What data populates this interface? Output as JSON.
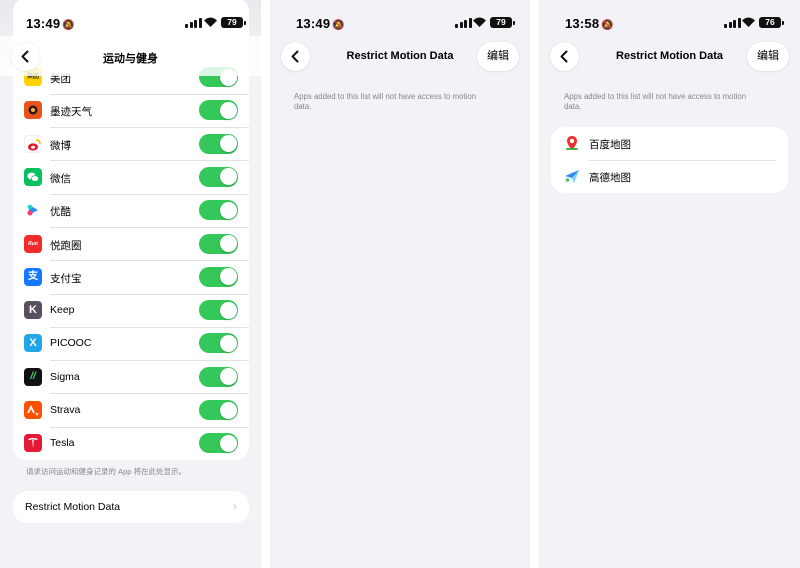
{
  "panel1": {
    "time": "13:49",
    "battery": "79",
    "nav_title": "运动与健身",
    "apps": [
      {
        "name": "美团",
        "icon": "meituan-icon",
        "color": "#ffd100",
        "enabled": true
      },
      {
        "name": "墨迹天气",
        "icon": "moji-weather-icon",
        "color": "#e8541b",
        "enabled": true
      },
      {
        "name": "微博",
        "icon": "weibo-icon",
        "color": "#f7b500",
        "enabled": true
      },
      {
        "name": "微信",
        "icon": "wechat-icon",
        "color": "#07c160",
        "enabled": true
      },
      {
        "name": "优酷",
        "icon": "youku-icon",
        "color": "#2c8cf2",
        "enabled": true
      },
      {
        "name": "悦跑圈",
        "icon": "yuepaoquan-icon",
        "color": "#ef2b2b",
        "enabled": true
      },
      {
        "name": "支付宝",
        "icon": "alipay-icon",
        "color": "#1677ff",
        "enabled": true
      },
      {
        "name": "Keep",
        "icon": "keep-icon",
        "color": "#584f60",
        "enabled": true
      },
      {
        "name": "PICOOC",
        "icon": "picooc-icon",
        "color": "#22a6e8",
        "enabled": true
      },
      {
        "name": "Sigma",
        "icon": "sigma-icon",
        "color": "#111111",
        "enabled": true
      },
      {
        "name": "Strava",
        "icon": "strava-icon",
        "color": "#fc5200",
        "enabled": true
      },
      {
        "name": "Tesla",
        "icon": "tesla-icon",
        "color": "#e31937",
        "enabled": true
      }
    ],
    "footnote": "请求访问运动和健身记录的 App 将在此处显示。",
    "restrict_label": "Restrict Motion Data"
  },
  "panel2": {
    "time": "13:49",
    "battery": "79",
    "nav_title": "Restrict Motion Data",
    "edit_label": "编辑",
    "note": "Apps added to this list will not have access to motion data."
  },
  "panel3": {
    "time": "13:58",
    "battery": "76",
    "nav_title": "Restrict Motion Data",
    "edit_label": "编辑",
    "note": "Apps added to this list will not have access to motion data.",
    "apps": [
      {
        "name": "百度地图",
        "icon": "baidu-maps-icon"
      },
      {
        "name": "高德地图",
        "icon": "amap-icon"
      }
    ]
  },
  "colors": {
    "toggle_on": "#34c759",
    "background": "#f2f2f7",
    "secondary_text": "#86868b"
  }
}
